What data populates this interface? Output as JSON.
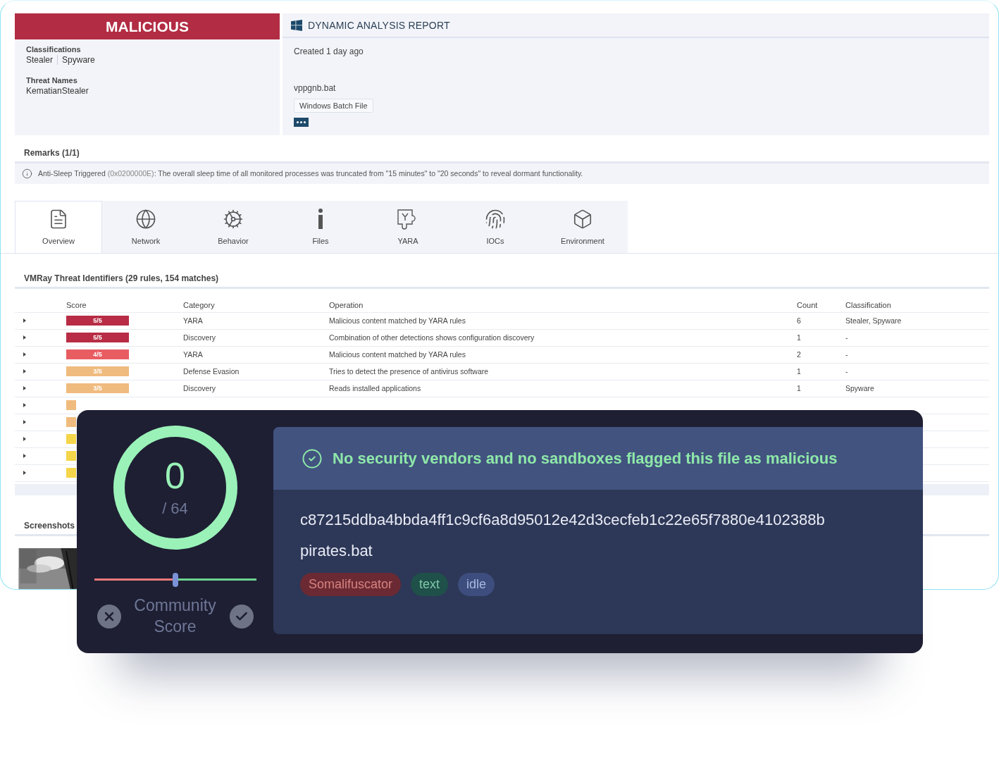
{
  "verdict": {
    "label": "MALICIOUS"
  },
  "summary": [
    {
      "title": "Classifications",
      "values": [
        "Stealer",
        "Spyware"
      ]
    },
    {
      "title": "Threat Names",
      "values": [
        "KematianStealer"
      ]
    }
  ],
  "report": {
    "title": "DYNAMIC ANALYSIS REPORT",
    "created": "Created 1 day ago",
    "filename": "vppgnb.bat",
    "file_type": "Windows Batch File"
  },
  "remarks": {
    "title": "Remarks (1/1)",
    "items": [
      {
        "name": "Anti-Sleep Triggered",
        "code": " (0x0200000E)",
        "text": ": The overall sleep time of all monitored processes was truncated from \"15 minutes\" to \"20 seconds\" to reveal dormant functionality."
      }
    ]
  },
  "tabs": [
    {
      "label": "Overview",
      "kind": "overview",
      "selected": true
    },
    {
      "label": "Network",
      "kind": "network",
      "selected": false
    },
    {
      "label": "Behavior",
      "kind": "behavior",
      "selected": false
    },
    {
      "label": "Files",
      "kind": "files",
      "selected": false
    },
    {
      "label": "YARA",
      "kind": "yara",
      "selected": false
    },
    {
      "label": "IOCs",
      "kind": "iocs",
      "selected": false
    },
    {
      "label": "Environment",
      "kind": "environment",
      "selected": false
    }
  ],
  "threat_identifiers": {
    "title": "VMRay Threat Identifiers (29 rules, 154 matches)",
    "columns": [
      "Score",
      "Category",
      "Operation",
      "Count",
      "Classification"
    ],
    "rows": [
      {
        "score": "5/5",
        "color": "#b82c45",
        "category": "YARA",
        "operation": "Malicious content matched by YARA rules",
        "count": "6",
        "classification": "Stealer, Spyware"
      },
      {
        "score": "5/5",
        "color": "#b82c45",
        "category": "Discovery",
        "operation": "Combination of other detections shows configuration discovery",
        "count": "1",
        "classification": "-"
      },
      {
        "score": "4/5",
        "color": "#e85d62",
        "category": "YARA",
        "operation": "Malicious content matched by YARA rules",
        "count": "2",
        "classification": "-"
      },
      {
        "score": "3/5",
        "color": "#f0bb7e",
        "category": "Defense Evasion",
        "operation": "Tries to detect the presence of antivirus software",
        "count": "1",
        "classification": "-"
      },
      {
        "score": "3/5",
        "color": "#f0bb7e",
        "category": "Discovery",
        "operation": "Reads installed applications",
        "count": "1",
        "classification": "Spyware"
      },
      {
        "color": "#f0bb7e"
      },
      {
        "color": "#f0bb7e"
      },
      {
        "color": "#f5d54a"
      },
      {
        "color": "#f5d54a"
      },
      {
        "color": "#f5d54a"
      }
    ]
  },
  "screenshots": {
    "title": "Screenshots"
  },
  "overlay": {
    "score": "0",
    "total": "/ 64",
    "community": {
      "label": "Community Score",
      "level": 0.5
    },
    "banner": "No security vendors and no sandboxes flagged this file as malicious",
    "hash": "c87215ddba4bbda4ff1c9cf6a8d95012e42d3cecfeb1c22e65f7880e4102388b",
    "filename": "pirates.bat",
    "tags": [
      {
        "label": "Somalifuscator",
        "kind": "danger"
      },
      {
        "label": "text",
        "kind": "success"
      },
      {
        "label": "idle",
        "kind": "info"
      }
    ]
  }
}
